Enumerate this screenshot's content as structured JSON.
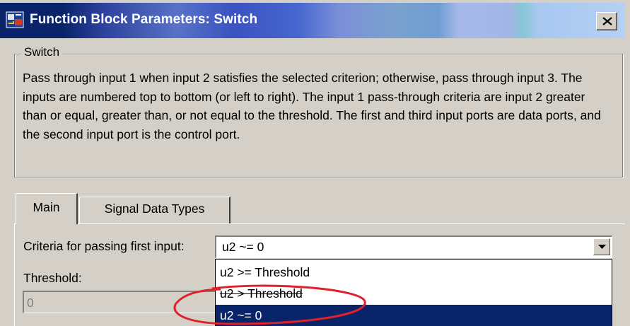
{
  "window": {
    "title": "Function Block Parameters: Switch",
    "close_glyph": "✕",
    "icon": "simulink-block-icon"
  },
  "group": {
    "label": "Switch",
    "description": "Pass through input 1 when input 2 satisfies the selected criterion; otherwise, pass through input 3.  The inputs are numbered top to bottom (or left to right). The input 1 pass-through criteria are input 2 greater than or equal, greater than, or not equal to the threshold.  The first and third input ports are data ports, and the second input port is the control port."
  },
  "tabs": [
    {
      "label": "Main",
      "selected": true
    },
    {
      "label": "Signal Data Types",
      "selected": false
    }
  ],
  "criteria": {
    "label": "Criteria for passing first input:",
    "value": "u2 ~= 0",
    "options": [
      "u2 >= Threshold",
      "u2 > Threshold",
      "u2 ~= 0"
    ],
    "highlighted_index": 2
  },
  "threshold": {
    "label": "Threshold:",
    "value": "0",
    "enabled": false
  },
  "colors": {
    "title_bar_dark": "#0a246a",
    "selection": "#0a246a",
    "dialog_face": "#d4d0c8",
    "annotation_circle": "#e0202a"
  }
}
